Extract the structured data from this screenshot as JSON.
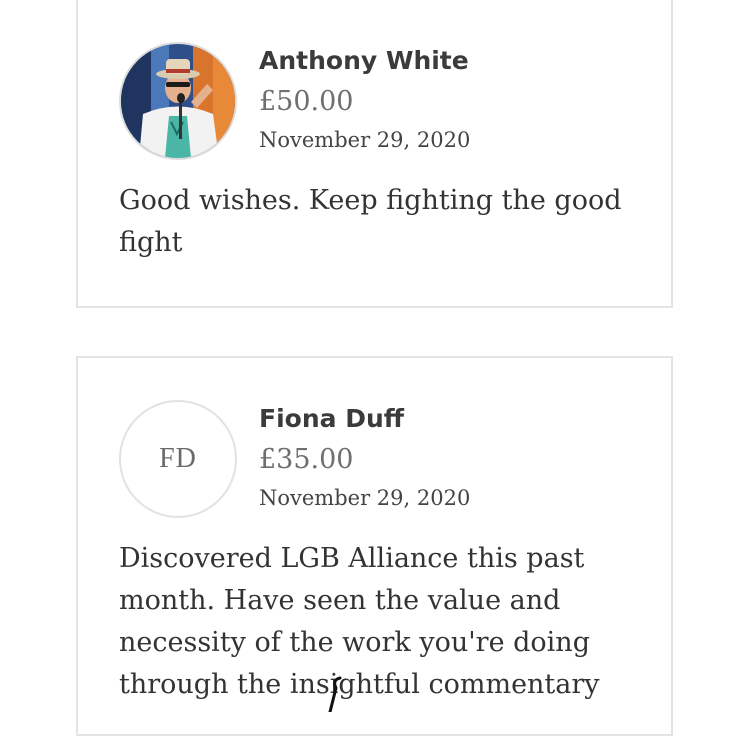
{
  "donations": [
    {
      "name": "Anthony White",
      "amount": "£50.00",
      "date": "November 29, 2020",
      "message": "Good wishes. Keep fighting the good fight",
      "avatar": {
        "type": "photo"
      }
    },
    {
      "name": "Fiona Duff",
      "amount": "£35.00",
      "date": "November 29, 2020",
      "message": "Discovered LGB Alliance this past month. Have seen the value and necessity of the work you're doing through the insightful commentary",
      "avatar": {
        "type": "initials",
        "initials": "FD"
      }
    }
  ]
}
